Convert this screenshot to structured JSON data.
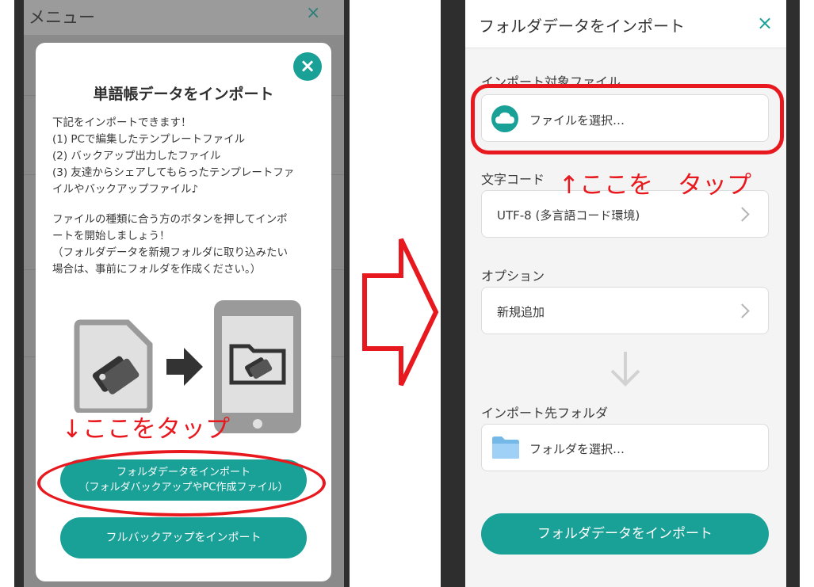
{
  "left": {
    "menu_title": "メニュー",
    "menu_close": "×",
    "modal": {
      "title": "単語帳データをインポート",
      "close": "×",
      "description": [
        "下記をインポートできます！",
        "(1) PCで編集したテンプレートファイル",
        "(2) バックアップ出力したファイル",
        "(3) 友達からシェアしてもらったテンプレートファ",
        "イルやバックアップファイル♪",
        "",
        "ファイルの種類に合う方のボタンを押してインポ",
        "ートを開始しましょう！",
        "（フォルダデータを新規フォルダに取り込みたい",
        "場合は、事前にフォルダを作成ください。）"
      ],
      "button_folder_line1": "フォルダデータをインポート",
      "button_folder_line2": "（フォルダバックアップやPC作成ファイル）",
      "button_full": "フルバックアップをインポート"
    },
    "annotation": "↓ここをタップ"
  },
  "right": {
    "title": "フォルダデータをインポート",
    "close": "×",
    "target_file_label": "インポート対象ファイル",
    "target_file_value": "ファイルを選択…",
    "encoding_label": "文字コード",
    "encoding_value": "UTF-8 (多言語コード環境)",
    "option_label": "オプション",
    "option_value": "新規追加",
    "dest_folder_label": "インポート先フォルダ",
    "dest_folder_value": "フォルダを選択…",
    "import_button": "フォルダデータをインポート",
    "annotation": "↑ここを　タップ"
  },
  "colors": {
    "accent": "#19a097",
    "annotation": "#e8191e"
  },
  "icons": [
    "close-icon",
    "document-tag-icon",
    "arrow-right-icon",
    "phone-folder-icon",
    "cloud-icon",
    "chevron-right-icon",
    "arrow-down-icon",
    "folder-icon"
  ]
}
